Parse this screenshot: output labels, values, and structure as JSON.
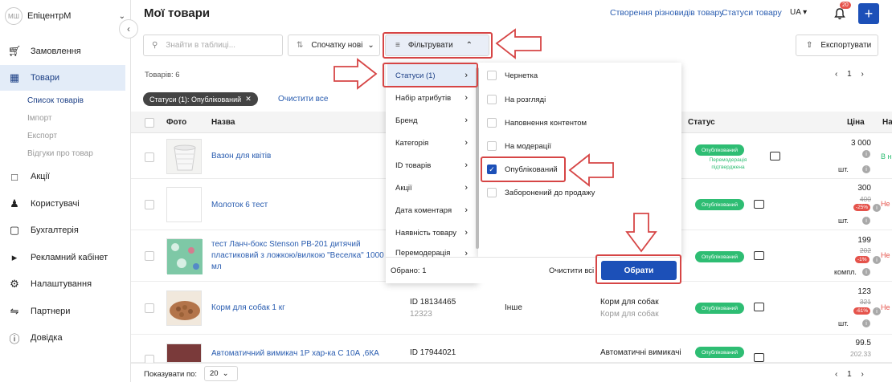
{
  "sidebar": {
    "avatar": "МШ",
    "store": "ЕпіцентрМ",
    "items": [
      {
        "label": "Замовлення",
        "icon": "cart-icon"
      },
      {
        "label": "Товари",
        "icon": "grid-icon"
      },
      {
        "label": "Акції",
        "icon": "percent-bag-icon"
      },
      {
        "label": "Користувачі",
        "icon": "users-icon"
      },
      {
        "label": "Бухгалтерія",
        "icon": "wallet-icon"
      },
      {
        "label": "Рекламний кабінет",
        "icon": "megaphone-icon"
      },
      {
        "label": "Налаштування",
        "icon": "gear-icon"
      },
      {
        "label": "Партнери",
        "icon": "handshake-icon"
      },
      {
        "label": "Довідка",
        "icon": "help-icon"
      }
    ],
    "subitems": [
      "Список товарів",
      "Імпорт",
      "Експорт",
      "Відгуки про товар"
    ]
  },
  "header": {
    "title": "Мої товари",
    "link1": "Створення різновидів товару",
    "link2": "Статуси товару",
    "lang": "UA",
    "notifications": "20",
    "plus": "+"
  },
  "toolbar": {
    "search_placeholder": "Знайти в таблиці...",
    "sort": "Спочатку нові",
    "filter": "Фільтрувати",
    "export": "Експортувати"
  },
  "meta": {
    "count": "Товарів: 6",
    "page": "1",
    "chip": "Статуси (1): Опублікований",
    "clear_all": "Очистити все"
  },
  "table": {
    "headers": {
      "photo": "Фото",
      "name": "Назва",
      "status": "Статус",
      "price": "Ціна",
      "avail": "На"
    },
    "rows": [
      {
        "name": "Вазон для квітів",
        "id": "",
        "id2": "",
        "col3": "",
        "col4": "",
        "col4b": "",
        "status": "Опублікований",
        "note": "Перемодерація підтверджена",
        "price": "3 000",
        "old": "",
        "disc": "",
        "unit": "шт.",
        "avail": "В н",
        "avail_color": "#2ebd73"
      },
      {
        "name": "Молоток 6 тест",
        "id": "",
        "id2": "",
        "col3": "",
        "col4": "",
        "col4b": "",
        "status": "Опублікований",
        "note": "",
        "price": "300",
        "old": "400",
        "disc": "-25%",
        "unit": "шт.",
        "avail": "Не",
        "avail_color": "#e5534b"
      },
      {
        "name": "тест Ланч-бокс Stenson PB-201 дитячий пластиковий з ложкою/вилкою \"Веселка\" 1000 мл",
        "id": "",
        "id2": "",
        "col3": "",
        "col4": "",
        "col4b": "",
        "status": "Опублікований",
        "note": "",
        "price": "199",
        "old": "202",
        "disc": "-1%",
        "unit": "компл.",
        "avail": "Не",
        "avail_color": "#e5534b"
      },
      {
        "name": "Корм для собак 1 кг",
        "id": "ID 18134465",
        "id2": "12323",
        "col3": "Інше",
        "col4": "Корм для собак",
        "col4b": "Корм для собак",
        "status": "Опублікований",
        "note": "",
        "price": "123",
        "old": "321",
        "disc": "-61%",
        "unit": "шт.",
        "avail": "Не",
        "avail_color": "#e5534b"
      },
      {
        "name": "Автоматичний вимикач 1Р хар-ка С 10А ,6КА",
        "id": "ID 17944021",
        "id2": "",
        "col3": "",
        "col4": "Автоматичні вимикачі",
        "col4b": "",
        "status": "Опублікований",
        "note": "",
        "price": "99.5",
        "old": "202.33",
        "disc": "",
        "unit": "",
        "avail": "",
        "avail_color": "#e5534b"
      }
    ]
  },
  "footer": {
    "per_page_label": "Показувати по:",
    "per_page": "20",
    "page": "1"
  },
  "dropdown": {
    "categories": [
      "Статуси (1)",
      "Набір атрибутів",
      "Бренд",
      "Категорія",
      "ID товарів",
      "Акції",
      "Дата коментаря",
      "Наявність товару",
      "Перемодерація"
    ],
    "options": [
      {
        "label": "Чернетка",
        "checked": false
      },
      {
        "label": "На розгляді",
        "checked": false
      },
      {
        "label": "Наповнення контентом",
        "checked": false
      },
      {
        "label": "На модерації",
        "checked": false
      },
      {
        "label": "Опублікований",
        "checked": true
      },
      {
        "label": "Заборонений до продажу",
        "checked": false
      }
    ],
    "selected": "Обрано: 1",
    "clear": "Очистити всі",
    "apply": "Обрати"
  },
  "colors": {
    "accent": "#1c50b8",
    "published": "#2ebd73",
    "annotation": "#d64545"
  }
}
